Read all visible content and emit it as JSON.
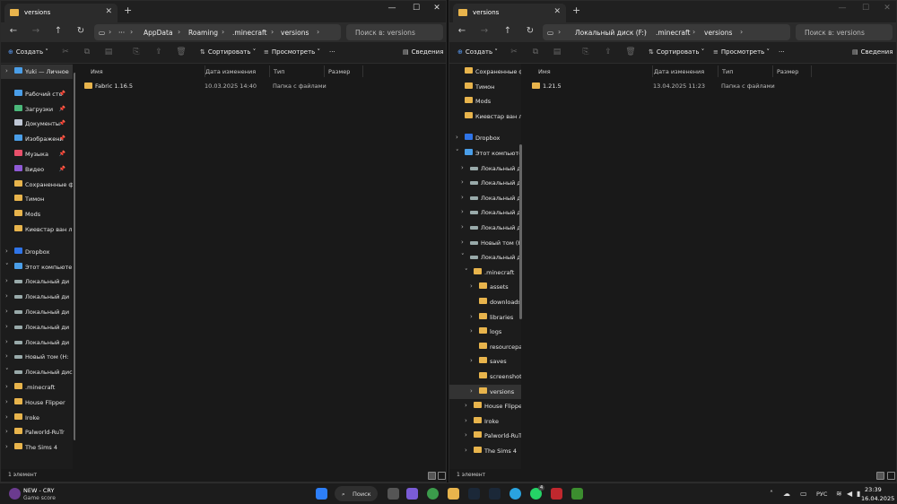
{
  "left": {
    "tab_title": "versions",
    "breadcrumbs": [
      "AppData",
      "Roaming",
      ".minecraft",
      "versions"
    ],
    "search_placeholder": "Поиск в: versions",
    "toolbar": {
      "create": "Создать",
      "sort": "Сортировать",
      "view": "Просмотреть",
      "details": "Сведения"
    },
    "sidebar": [
      {
        "label": "Yuki — Личное",
        "type": "cloud",
        "chev": true,
        "sel": true
      },
      {
        "label": "Рабочий сто",
        "type": "desktop",
        "pin": true
      },
      {
        "label": "Загрузки",
        "type": "download",
        "pin": true
      },
      {
        "label": "Документы",
        "type": "docs",
        "pin": true
      },
      {
        "label": "Изображени",
        "type": "pics",
        "pin": true
      },
      {
        "label": "Музыка",
        "type": "music",
        "pin": true
      },
      {
        "label": "Видео",
        "type": "video",
        "pin": true
      },
      {
        "label": "Сохраненные ф",
        "type": "folder"
      },
      {
        "label": "Тимон",
        "type": "folder"
      },
      {
        "label": "Mods",
        "type": "folder"
      },
      {
        "label": "Киевстар ван л",
        "type": "folder"
      },
      {
        "label": "Dropbox",
        "type": "dropbox",
        "chev": true
      },
      {
        "label": "Этот компьюте",
        "type": "pc",
        "chev": true,
        "open": true
      },
      {
        "label": "Локальный ди",
        "type": "drive",
        "chev": true
      },
      {
        "label": "Локальный ди",
        "type": "drive",
        "chev": true
      },
      {
        "label": "Локальный ди",
        "type": "drive",
        "chev": true
      },
      {
        "label": "Локальный ди",
        "type": "drive",
        "chev": true
      },
      {
        "label": "Локальный ди",
        "type": "drive",
        "chev": true
      },
      {
        "label": "Новый том (H:",
        "type": "drive",
        "chev": true
      },
      {
        "label": "Локальный дис",
        "type": "drive",
        "chev": true,
        "open": true
      },
      {
        "label": ".minecraft",
        "type": "folder",
        "chev": true
      },
      {
        "label": "House Flipper",
        "type": "folder",
        "chev": true
      },
      {
        "label": "Iroke",
        "type": "folder",
        "chev": true
      },
      {
        "label": "Palworld-RuTr",
        "type": "folder",
        "chev": true
      },
      {
        "label": "The Sims 4",
        "type": "folder",
        "chev": true
      }
    ],
    "columns": [
      "Имя",
      "Дата изменения",
      "Тип",
      "Размер"
    ],
    "rows": [
      {
        "name": "Fabric 1.16.5",
        "date": "10.03.2025 14:40",
        "type": "Папка с файлами",
        "size": ""
      }
    ],
    "status": "1 элемент"
  },
  "right": {
    "tab_title": "versions",
    "breadcrumbs": [
      "Локальный диск (F:)",
      ".minecraft",
      "versions"
    ],
    "search_placeholder": "Поиск в: versions",
    "toolbar": {
      "create": "Создать",
      "sort": "Сортировать",
      "view": "Просмотреть",
      "details": "Сведения"
    },
    "sidebar": [
      {
        "label": "Сохраненные ф",
        "type": "folder"
      },
      {
        "label": "Тимон",
        "type": "folder"
      },
      {
        "label": "Mods",
        "type": "folder"
      },
      {
        "label": "Киевстар ван л",
        "type": "folder"
      },
      {
        "label": "",
        "type": "blank"
      },
      {
        "label": "Dropbox",
        "type": "dropbox",
        "chev": true
      },
      {
        "label": "Этот компьюте",
        "type": "pc",
        "chev": true,
        "open": true
      },
      {
        "label": "Локальный ди",
        "type": "drive",
        "chev": true,
        "indent": true
      },
      {
        "label": "Локальный ди",
        "type": "drive",
        "chev": true,
        "indent": true
      },
      {
        "label": "Локальный ди",
        "type": "drive",
        "chev": true,
        "indent": true
      },
      {
        "label": "Локальный ди",
        "type": "drive",
        "chev": true,
        "indent": true
      },
      {
        "label": "Локальный ди",
        "type": "drive",
        "chev": true,
        "indent": true
      },
      {
        "label": "Новый том (H:",
        "type": "drive",
        "chev": true,
        "indent": true
      },
      {
        "label": "Локальный дис",
        "type": "drive",
        "chev": true,
        "open": true,
        "indent": true
      },
      {
        "label": ".minecraft",
        "type": "folder",
        "chev": true,
        "open": true,
        "indent2": true
      },
      {
        "label": "assets",
        "type": "folder",
        "chev": true,
        "indent3": true
      },
      {
        "label": "downloads",
        "type": "folder",
        "indent3": true
      },
      {
        "label": "libraries",
        "type": "folder",
        "chev": true,
        "indent3": true
      },
      {
        "label": "logs",
        "type": "folder",
        "chev": true,
        "indent3": true
      },
      {
        "label": "resourcepack",
        "type": "folder",
        "indent3": true
      },
      {
        "label": "saves",
        "type": "folder",
        "chev": true,
        "indent3": true
      },
      {
        "label": "screenshots",
        "type": "folder",
        "indent3": true
      },
      {
        "label": "versions",
        "type": "folder",
        "chev": true,
        "indent3": true,
        "sel": true
      },
      {
        "label": "House Flipper",
        "type": "folder",
        "chev": true,
        "indent2": true
      },
      {
        "label": "Iroke",
        "type": "folder",
        "chev": true,
        "indent2": true
      },
      {
        "label": "Palworld-RuTr",
        "type": "folder",
        "chev": true,
        "indent2": true
      },
      {
        "label": "The Sims 4",
        "type": "folder",
        "chev": true,
        "indent2": true
      }
    ],
    "columns": [
      "Имя",
      "Дата изменения",
      "Тип",
      "Размер"
    ],
    "rows": [
      {
        "name": "1.21.5",
        "date": "13.04.2025 11:23",
        "type": "Папка с файлами",
        "size": ""
      }
    ],
    "status": "1 элемент"
  },
  "taskbar": {
    "media_title": "NEW - CRY",
    "media_sub": "Game score",
    "search_label": "Поиск",
    "lang": "РУС",
    "time": "23:39",
    "date": "16.04.2025",
    "badge": "4"
  },
  "colors": {
    "folder": "#e8b44c",
    "accent": "#5aa0ff",
    "bg": "#191919"
  }
}
